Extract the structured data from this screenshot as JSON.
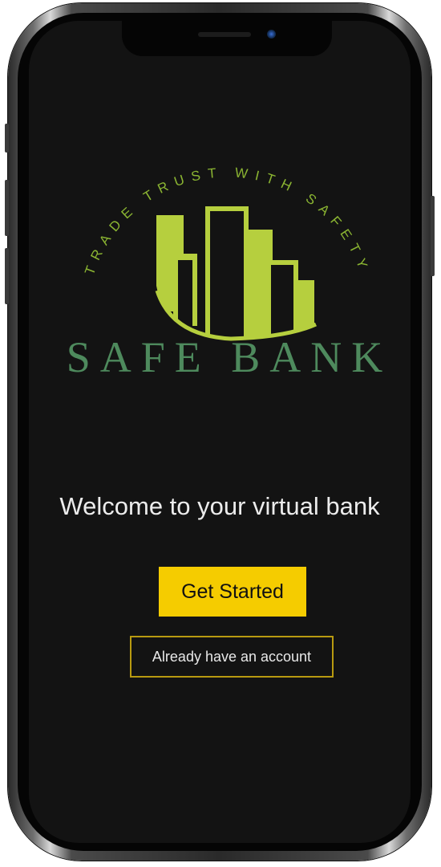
{
  "brand": {
    "tagline": "TRADE TRUST WITH SAFETY",
    "name": "SAFE BANK",
    "logo_icon": "building-skyline-icon"
  },
  "welcome": {
    "message": "Welcome to your virtual bank"
  },
  "actions": {
    "get_started_label": "Get Started",
    "login_label": "Already have an account"
  },
  "colors": {
    "screen_background": "#131313",
    "logo_green": "#b6cf3e",
    "brand_text_green": "#4e8a5d",
    "primary_button": "#f5cc00",
    "secondary_border": "#b89a10",
    "text_light": "#ececec"
  }
}
